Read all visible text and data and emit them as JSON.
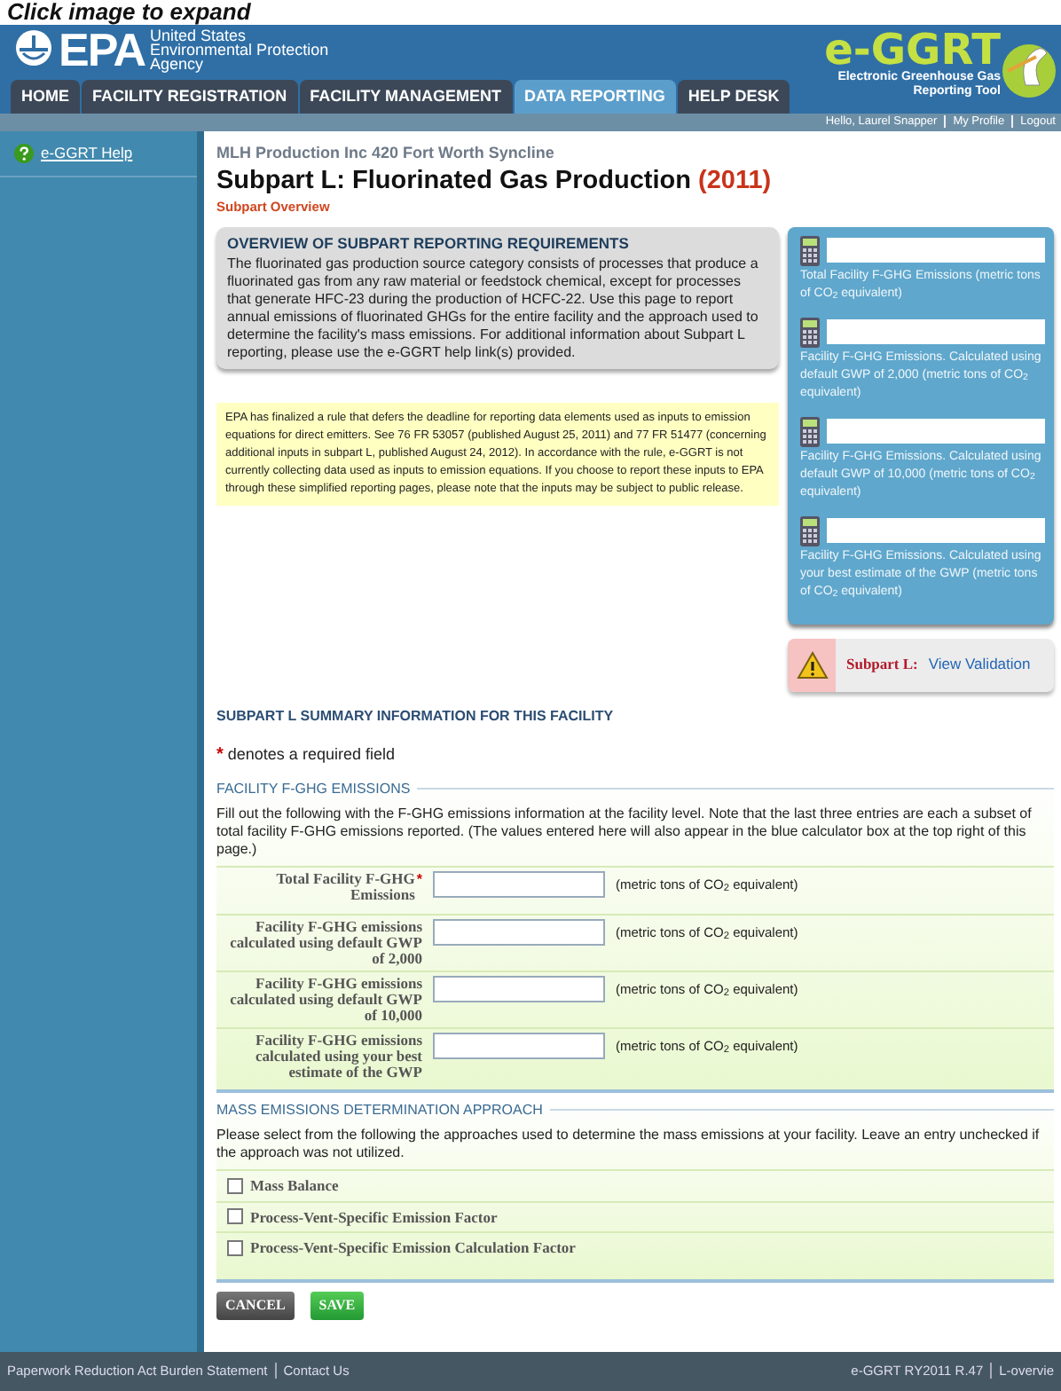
{
  "caption": "Click image to expand",
  "header": {
    "agency_logo": "EPA",
    "agency_lines": [
      "United States",
      "Environmental Protection",
      "Agency"
    ],
    "app_logo": "e-GGRT",
    "app_subtitle": [
      "Electronic Greenhouse Gas",
      "Reporting Tool"
    ],
    "tabs": [
      {
        "label": "HOME",
        "selected": false
      },
      {
        "label": "FACILITY REGISTRATION",
        "selected": false
      },
      {
        "label": "FACILITY MANAGEMENT",
        "selected": false
      },
      {
        "label": "DATA REPORTING",
        "selected": true
      },
      {
        "label": "HELP DESK",
        "selected": false
      }
    ],
    "user_links": [
      "Hello, Laurel Snapper",
      "My Profile",
      "Logout"
    ]
  },
  "sidebar": {
    "items": [
      {
        "label": "e-GGRT Help"
      }
    ]
  },
  "page": {
    "facility": "MLH Production Inc 420 Fort Worth Syncline",
    "title": "Subpart L: Fluorinated Gas Production",
    "year": "(2011)",
    "subtitle": "Subpart Overview"
  },
  "overview": {
    "heading": "OVERVIEW OF SUBPART REPORTING REQUIREMENTS",
    "text": "The fluorinated gas production source category consists of processes that produce a fluorinated gas from any raw material or feedstock chemical, except for processes that generate HFC-23 during the production of HCFC-22. Use this page to report annual emissions of fluorinated GHGs for the entire facility and the approach used to determine the facility's mass emissions. For additional information about Subpart L reporting, please use the e-GGRT help link(s) provided."
  },
  "notice": "EPA has finalized a rule that defers the deadline for reporting data elements used as inputs to emission equations for direct emitters. See 76 FR 53057 (published August 25, 2011) and 77 FR 51477 (concerning additional inputs in subpart L, published August 24, 2012). In accordance with the rule, e-GGRT is not currently collecting data used as inputs to emission equations. If you choose to report these inputs to EPA through these simplified reporting pages, please note that the inputs may be subject to public release.",
  "calculator": [
    {
      "label": "Total Facility F-GHG Emissions (metric tons of CO$_{2}$ equivalent)"
    },
    {
      "label": "Facility F-GHG Emissions. Calculated using default GWP of 2,000 (metric tons of CO$_{2}$ equivalent)"
    },
    {
      "label": "Facility F-GHG Emissions. Calculated using default GWP of 10,000 (metric tons of CO$_{2}$ equivalent)"
    },
    {
      "label": "Facility F-GHG Emissions. Calculated using your best estimate of the GWP (metric tons of CO$_{2}$ equivalent)"
    }
  ],
  "validation": {
    "label": "Subpart L:",
    "link": "View Validation"
  },
  "summary": {
    "heading": "SUBPART L SUMMARY INFORMATION FOR THIS FACILITY",
    "required_mark": "*",
    "required_note": "denotes a required field"
  },
  "emissions": {
    "legend": "FACILITY F-GHG EMISSIONS",
    "intro": "Fill out the following with the F-GHG emissions information at the facility level. Note that the last three entries are each a subset of total facility F-GHG emissions reported. (The values entered here will also appear in the blue calculator box at the top right of this page.)",
    "rows": [
      {
        "label": "Total Facility F-GHG Emissions",
        "required": true,
        "unit": "(metric tons of CO$_{2}$ equivalent)"
      },
      {
        "label": "Facility F-GHG emissions calculated using default GWP of 2,000",
        "required": false,
        "unit": "(metric tons of CO$_{2}$ equivalent)"
      },
      {
        "label": "Facility F-GHG emissions calculated using default GWP of 10,000",
        "required": false,
        "unit": "(metric tons of CO$_{2}$ equivalent)"
      },
      {
        "label": "Facility F-GHG emissions calculated using your best estimate of the GWP",
        "required": false,
        "unit": "(metric tons of CO$_{2}$ equivalent)"
      }
    ]
  },
  "approach": {
    "legend": "MASS EMISSIONS DETERMINATION APPROACH",
    "intro": "Please select from the following the approaches used to determine the mass emissions at your facility. Leave an entry unchecked if the approach was not utilized.",
    "options": [
      {
        "label": "Mass Balance",
        "checked": false
      },
      {
        "label": "Process-Vent-Specific Emission Factor",
        "checked": false
      },
      {
        "label": "Process-Vent-Specific Emission Calculation Factor",
        "checked": false
      }
    ]
  },
  "buttons": [
    {
      "label": "CANCEL",
      "kind": "cancel"
    },
    {
      "label": "SAVE",
      "kind": "save"
    }
  ],
  "footer": {
    "left": [
      "Paperwork Reduction Act Burden Statement",
      "Contact Us"
    ],
    "right": [
      "e-GGRT RY2011 R.47",
      "L-overvie"
    ]
  }
}
